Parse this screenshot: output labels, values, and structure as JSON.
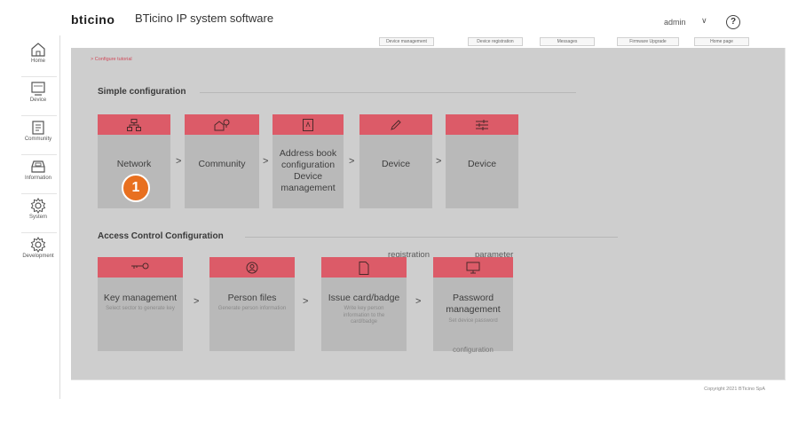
{
  "header": {
    "logo": "bticino",
    "app_title": "BTicino IP system software",
    "user": "admin",
    "user_chevron": "∨",
    "help": "?"
  },
  "sidebar": {
    "items": [
      {
        "label": "Home",
        "icon": "home-icon"
      },
      {
        "label": "Device",
        "icon": "device-icon"
      },
      {
        "label": "Community",
        "icon": "community-icon"
      },
      {
        "label": "Information",
        "icon": "information-icon"
      },
      {
        "label": "System",
        "icon": "system-gear-icon"
      },
      {
        "label": "Development",
        "icon": "development-gear-icon"
      }
    ]
  },
  "toolbar": {
    "buttons": [
      "Device management",
      "Device registration",
      "Messages",
      "Firmware Upgrade",
      "Home page"
    ]
  },
  "main": {
    "breadcrumb": "> Configure tutorial",
    "simple_section": {
      "title": "Simple configuration",
      "cards": [
        {
          "title": "Network",
          "icon": "network-icon"
        },
        {
          "title": "Community",
          "icon": "community-card-icon"
        },
        {
          "title": "Address book configuration Device management",
          "icon": "address-book-icon"
        },
        {
          "title": "Device",
          "icon": "pencil-icon"
        },
        {
          "title": "Device",
          "icon": "sliders-icon"
        }
      ],
      "ghost_labels": [
        "registration",
        "parameter"
      ]
    },
    "access_section": {
      "title": "Access Control Configuration",
      "cards": [
        {
          "title": "Key management",
          "subtitle": "Select sector to generate key",
          "icon": "key-icon"
        },
        {
          "title": "Person files",
          "subtitle": "Generate person information",
          "icon": "person-icon"
        },
        {
          "title": "Issue card/badge",
          "subtitle": "Write key person information to the card/badge",
          "icon": "card-icon"
        },
        {
          "title": "Password management",
          "subtitle": "Set device password",
          "icon": "monitor-icon"
        }
      ],
      "ghost_label": "configuration"
    },
    "arrow": ">",
    "step_badge": "1"
  },
  "footer": {
    "copyright": "Copyright 2021 BTicino SpA"
  },
  "colors": {
    "accent_red": "#dc5b68",
    "panel_gray": "#cecece",
    "card_gray": "#b9b9b9",
    "badge_orange": "#e87020",
    "brand_orange": "#f4a000"
  }
}
